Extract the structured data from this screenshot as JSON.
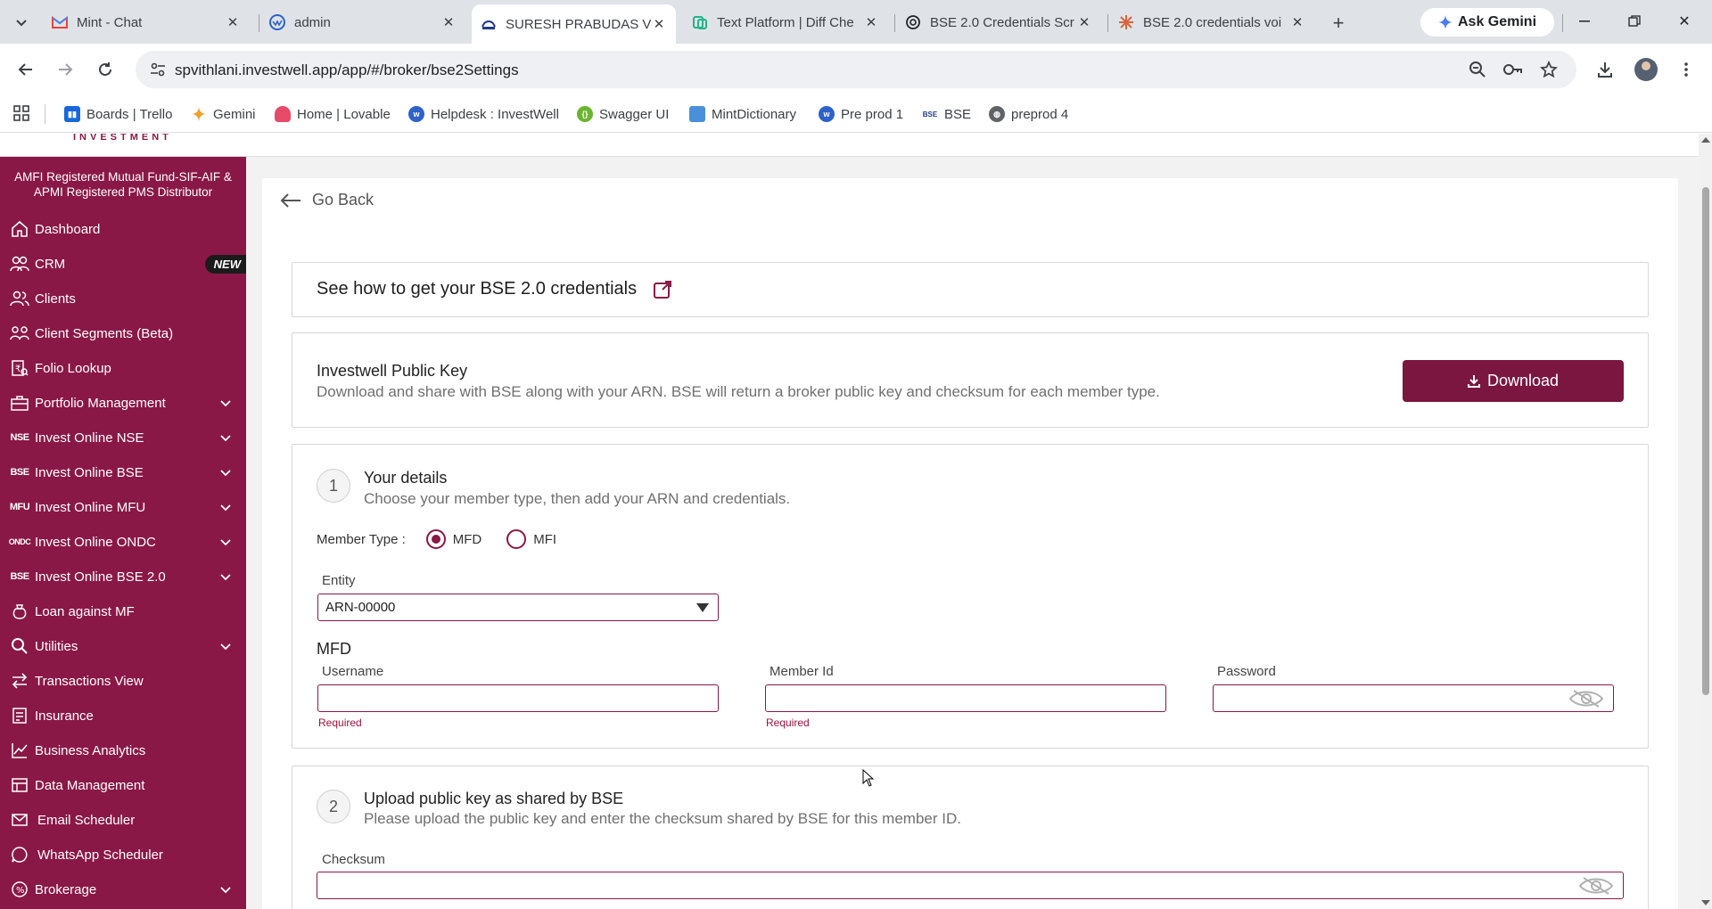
{
  "browser": {
    "tabs": [
      {
        "label": "Mint - Chat",
        "icon": "gmail-icon"
      },
      {
        "label": "admin",
        "icon": "investwell-icon"
      },
      {
        "label": "SURESH PRABUDAS VI",
        "icon": "suresh-icon",
        "active": true
      },
      {
        "label": "Text Platform | Diff Che",
        "icon": "diff-icon"
      },
      {
        "label": "BSE 2.0 Credentials Scr",
        "icon": "openai-icon"
      },
      {
        "label": "BSE 2.0 credentials voi",
        "icon": "claude-icon"
      }
    ],
    "ask_gemini": "Ask Gemini",
    "url": "spvithlani.investwell.app/app/#/broker/bse2Settings",
    "bookmarks": [
      {
        "label": "Boards | Trello",
        "color": "#1868db"
      },
      {
        "label": "Gemini",
        "color": "#4a7cf0"
      },
      {
        "label": "Home | Lovable",
        "color": "#e84a6a"
      },
      {
        "label": "Helpdesk : InvestWell",
        "color": "#2e62c9"
      },
      {
        "label": "Swagger UI",
        "color": "#6bb42f"
      },
      {
        "label": "MintDictionary",
        "color": "#4a90d9"
      },
      {
        "label": "Pre prod 1",
        "color": "#2e62c9"
      },
      {
        "label": "BSE",
        "color": "#1f3a8a"
      },
      {
        "label": "preprod 4",
        "color": "#5f6368"
      }
    ]
  },
  "app": {
    "logo_fragment": "INVESTMENT",
    "brand_color": "#8a1846",
    "sidebar": {
      "amfi_text": "AMFI Registered Mutual Fund-SIF-AIF & APMI Registered PMS Distributor",
      "items": [
        {
          "label": "Dashboard",
          "icon": "home-icon"
        },
        {
          "label": "CRM",
          "icon": "crm-icon",
          "badge": "NEW"
        },
        {
          "label": "Clients",
          "icon": "clients-icon"
        },
        {
          "label": "Client Segments (Beta)",
          "icon": "segments-icon"
        },
        {
          "label": "Folio Lookup",
          "icon": "folio-icon"
        },
        {
          "label": "Portfolio Management",
          "icon": "briefcase-icon",
          "expandable": true
        },
        {
          "label": "Invest Online NSE",
          "icon": "nse-icon",
          "code": "NSE",
          "expandable": true
        },
        {
          "label": "Invest Online BSE",
          "icon": "bse-icon",
          "code": "BSE",
          "expandable": true
        },
        {
          "label": "Invest Online MFU",
          "icon": "mfu-icon",
          "code": "MFU",
          "expandable": true
        },
        {
          "label": "Invest Online ONDC",
          "icon": "ondc-icon",
          "code": "ONDC",
          "expandable": true
        },
        {
          "label": "Invest Online BSE 2.0",
          "icon": "bse2-icon",
          "code": "BSE",
          "expandable": true
        },
        {
          "label": "Loan against MF",
          "icon": "loan-icon"
        },
        {
          "label": "Utilities",
          "icon": "utilities-icon",
          "expandable": true
        },
        {
          "label": "Transactions View",
          "icon": "transactions-icon"
        },
        {
          "label": "Insurance",
          "icon": "insurance-icon"
        },
        {
          "label": "Business Analytics",
          "icon": "analytics-icon"
        },
        {
          "label": "Data Management",
          "icon": "data-icon"
        },
        {
          "label": "Email Scheduler",
          "icon": "email-icon"
        },
        {
          "label": "WhatsApp Scheduler",
          "icon": "whatsapp-icon"
        },
        {
          "label": "Brokerage",
          "icon": "brokerage-icon",
          "expandable": true
        }
      ]
    },
    "go_back": "Go Back",
    "help_card": {
      "title": "See how to get your BSE 2.0 credentials"
    },
    "public_key": {
      "title": "Investwell Public Key",
      "subtitle": "Download and share with BSE along with your ARN. BSE will return a broker public key and checksum for each member type.",
      "download_label": "Download"
    },
    "step1": {
      "number": "1",
      "title": "Your details",
      "subtitle": "Choose your member type, then add your ARN and credentials.",
      "member_type_label": "Member Type :",
      "options": [
        "MFD",
        "MFI"
      ],
      "selected": "MFD",
      "entity_label": "Entity",
      "entity_value": "ARN-00000",
      "section_heading": "MFD",
      "username_label": "Username",
      "member_id_label": "Member Id",
      "password_label": "Password",
      "required_text": "Required"
    },
    "step2": {
      "number": "2",
      "title": "Upload public key as shared by BSE",
      "subtitle": "Please upload the public key and enter the checksum shared by BSE for this member ID.",
      "checksum_label": "Checksum"
    }
  }
}
